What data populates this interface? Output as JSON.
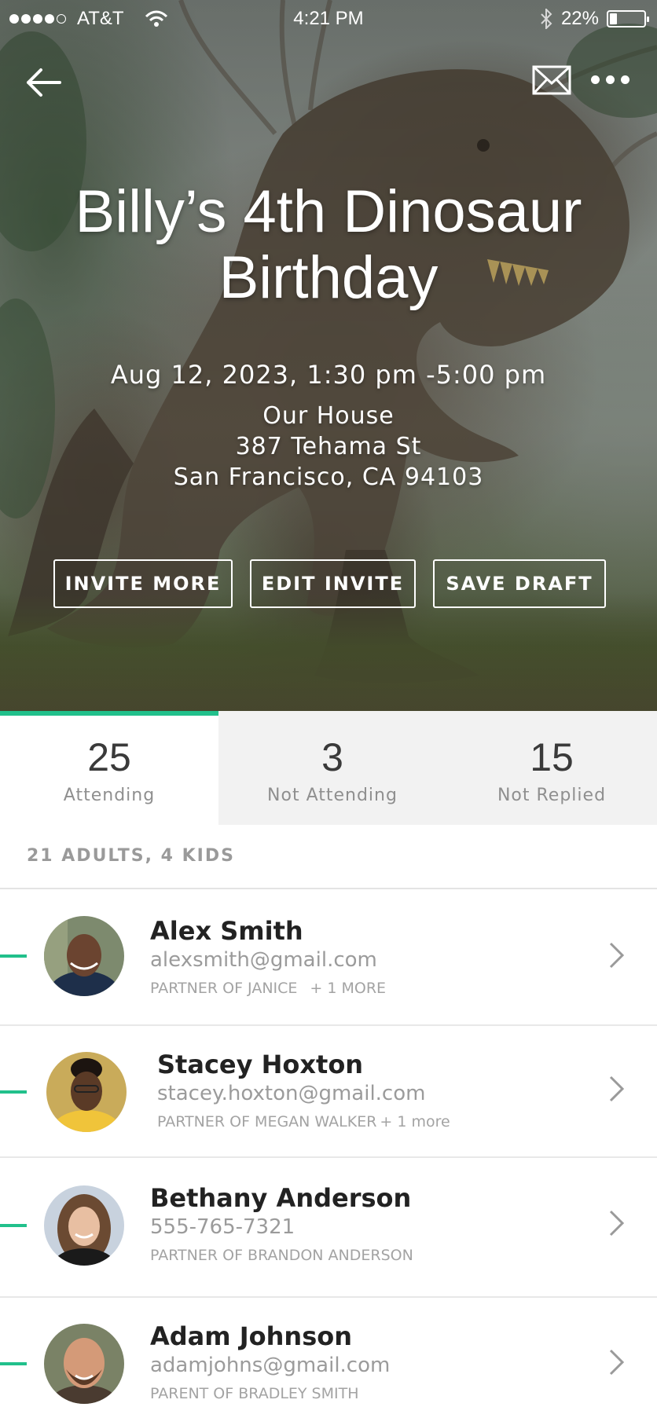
{
  "status_bar": {
    "carrier": "AT&T",
    "time": "4:21 PM",
    "battery": "22%",
    "battery_level": 0.22,
    "icons": [
      "signal-dots-icon",
      "wifi-icon",
      "bluetooth-icon",
      "battery-icon"
    ]
  },
  "nav": {
    "icons": [
      "back-arrow-icon",
      "envelope-icon",
      "more-dots-icon"
    ]
  },
  "event": {
    "title": "Billy’s 4th Dinosaur Birthday",
    "date": "Aug 12, 2023, 1:30 pm -5:00 pm",
    "address": {
      "line1": "Our House",
      "line2": "387 Tehama St",
      "line3": "San Francisco, CA 94103"
    }
  },
  "actions": {
    "invite_more": "INVITE MORE",
    "edit_invite": "EDIT INVITE",
    "save_draft": "SAVE DRAFT"
  },
  "rsvp_tabs": [
    {
      "count": "25",
      "label": "Attending",
      "active": true
    },
    {
      "count": "3",
      "label": "Not Attending",
      "active": false
    },
    {
      "count": "15",
      "label": "Not Replied",
      "active": false
    }
  ],
  "summary": "21 ADULTS, 4 KIDS",
  "accent_color": "#21c08b",
  "guests": [
    {
      "name": "Alex Smith",
      "contact": "alexsmith@gmail.com",
      "relation": "PARTNER OF JANICE",
      "more": "+ 1 MORE"
    },
    {
      "name": "Stacey Hoxton",
      "contact": "stacey.hoxton@gmail.com",
      "relation": "PARTNER OF MEGAN WALKER",
      "more": "+ 1 more"
    },
    {
      "name": "Bethany Anderson",
      "contact": "555-765-7321",
      "relation": "PARTNER OF BRANDON ANDERSON",
      "more": ""
    },
    {
      "name": "Adam Johnson",
      "contact": "adamjohns@gmail.com",
      "relation": "PARENT OF BRADLEY SMITH",
      "more": ""
    }
  ]
}
